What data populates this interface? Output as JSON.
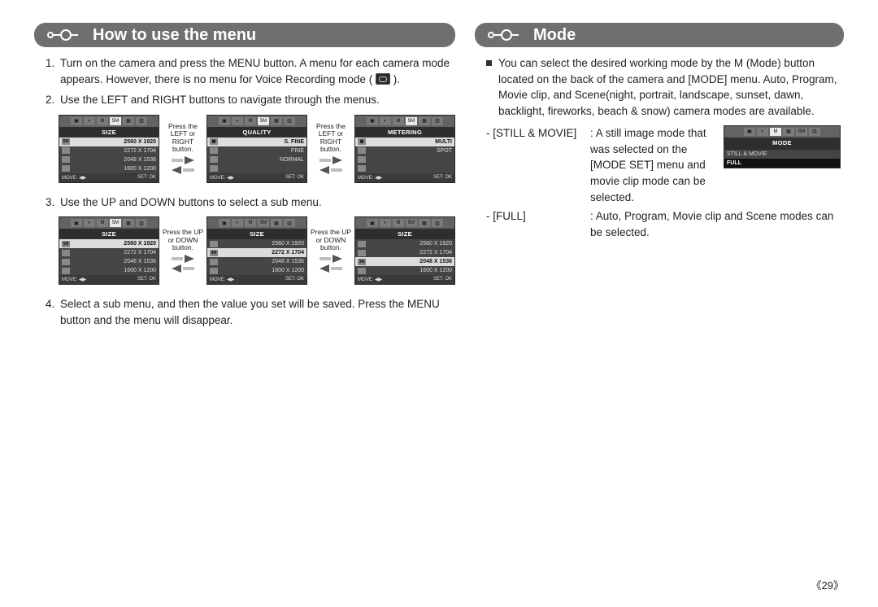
{
  "left": {
    "title": "How to use the menu",
    "step1a": "Turn on the camera and press the MENU button. A menu for each camera mode appears. However, there is no menu for Voice Recording mode (",
    "step1b": ").",
    "step2": "Use the LEFT and RIGHT buttons to navigate through the menus.",
    "step3": "Use the UP and DOWN buttons to select a sub menu.",
    "step4": "Select a sub menu, and then the value you set will be saved. Press the MENU button and the menu will disappear.",
    "between_lr": "Press the LEFT or RIGHT button.",
    "between_ud": "Press the UP or DOWN button.",
    "foot_move": "MOVE: ◀▶",
    "foot_set": "SET: OK",
    "top_chips": [
      "▣",
      "◐",
      "M",
      "5M",
      "▦",
      "▥"
    ],
    "lcd_row1": {
      "title": "SIZE",
      "rows": [
        {
          "ico": "5M",
          "txt": "2560 X 1920",
          "sel": true
        },
        {
          "ico": "",
          "txt": "2272 X 1704"
        },
        {
          "ico": "",
          "txt": "2048 X 1536"
        },
        {
          "ico": "",
          "txt": "1600 X 1200"
        }
      ]
    },
    "lcd_row1_b": {
      "title": "QUALITY",
      "rows": [
        {
          "ico": "▦",
          "txt": "S. FINE",
          "sel": true
        },
        {
          "ico": "",
          "txt": "FINE"
        },
        {
          "ico": "",
          "txt": "NORMAL"
        },
        {
          "ico": "",
          "txt": ""
        }
      ]
    },
    "lcd_row1_c": {
      "title": "METERING",
      "rows": [
        {
          "ico": "▣",
          "txt": "MULTI",
          "sel": true
        },
        {
          "ico": "",
          "txt": "SPOT"
        },
        {
          "ico": "",
          "txt": ""
        },
        {
          "ico": "",
          "txt": ""
        }
      ]
    },
    "lcd_row2_a": {
      "title": "SIZE",
      "active": "5M",
      "rows": [
        {
          "ico": "5M",
          "txt": "2560 X 1920",
          "sel": true
        },
        {
          "ico": "",
          "txt": "2272 X 1704"
        },
        {
          "ico": "",
          "txt": "2048 X 1536"
        },
        {
          "ico": "",
          "txt": "1600 X 1200"
        }
      ]
    },
    "lcd_row2_b": {
      "title": "SIZE",
      "active": "4M",
      "rows": [
        {
          "ico": "",
          "txt": "2560 X 1920"
        },
        {
          "ico": "4M",
          "txt": "2272 X 1704",
          "sel": true
        },
        {
          "ico": "",
          "txt": "2048 X 1536"
        },
        {
          "ico": "",
          "txt": "1600 X 1200"
        }
      ]
    },
    "lcd_row2_c": {
      "title": "SIZE",
      "active": "3M",
      "rows": [
        {
          "ico": "",
          "txt": "2560 X 1920"
        },
        {
          "ico": "",
          "txt": "2272 X 1704"
        },
        {
          "ico": "3M",
          "txt": "2048 X 1536",
          "sel": true
        },
        {
          "ico": "",
          "txt": "1600 X 1200"
        }
      ]
    }
  },
  "right": {
    "title": "Mode",
    "intro": "You can select the desired working mode by the M (Mode) button located on the back of the camera and [MODE] menu. Auto, Program, Movie clip, and Scene(night, portrait, landscape, sunset, dawn, backlight, fireworks, beach & snow) camera modes are available.",
    "def1_key": "- [STILL & MOVIE]",
    "def1_sep": ":",
    "def1_val": "A still image mode that was selected on the [MODE SET] menu and movie clip mode can be selected.",
    "def2_key": "- [FULL]",
    "def2_sep": ":",
    "def2_val": "Auto, Program, Movie clip and Scene modes can be selected.",
    "mode_lcd": {
      "title": "MODE",
      "chips": [
        "▣",
        "◐",
        "M",
        "▦",
        "5M",
        "▥"
      ],
      "rows": [
        {
          "txt": "STILL & MOVIE"
        },
        {
          "txt": "FULL",
          "full": true
        }
      ]
    }
  },
  "page": "《29》"
}
